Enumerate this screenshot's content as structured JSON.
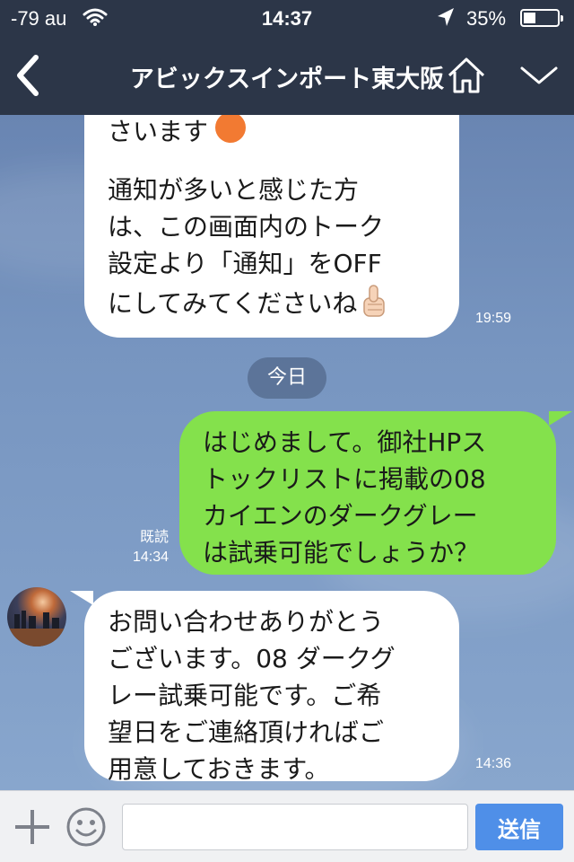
{
  "status_bar": {
    "carrier": "-79 au",
    "time": "14:37",
    "battery_percent": "35%",
    "battery_level": 0.35
  },
  "header": {
    "title": "アビックスインポート東大阪",
    "back_icon": "chevron-left-icon",
    "home_icon": "home-icon",
    "menu_icon": "chevron-down-icon"
  },
  "chat": {
    "date_divider": "今日",
    "messages": [
      {
        "side": "in",
        "lines": [
          "さいます",
          "",
          "通知が多いと感じた方",
          "は、この画面内のトーク",
          "設定より「通知」をOFF",
          "にしてみてくださいね"
        ],
        "time": "19:59"
      },
      {
        "side": "out",
        "lines": [
          "はじめまして。御社HPス",
          "トックリストに掲載の08",
          "カイエンのダークグレー",
          "は試乗可能でしょうか？"
        ],
        "read": "既読",
        "time": "14:34"
      },
      {
        "side": "in",
        "lines": [
          "お問い合わせありがとう",
          "ございます。08 ダークグ",
          "レー試乗可能です。ご希",
          "望日をご連絡頂ければご",
          "用意しておきます。"
        ],
        "time": "14:36"
      }
    ]
  },
  "input": {
    "placeholder": "",
    "send_label": "送信",
    "plus_icon": "plus-icon",
    "emoji_icon": "smiley-icon"
  },
  "colors": {
    "header_bg": "#2c3648",
    "outgoing_bubble": "#84e14c",
    "incoming_bubble": "#ffffff",
    "send_button": "#4f8fe8"
  }
}
